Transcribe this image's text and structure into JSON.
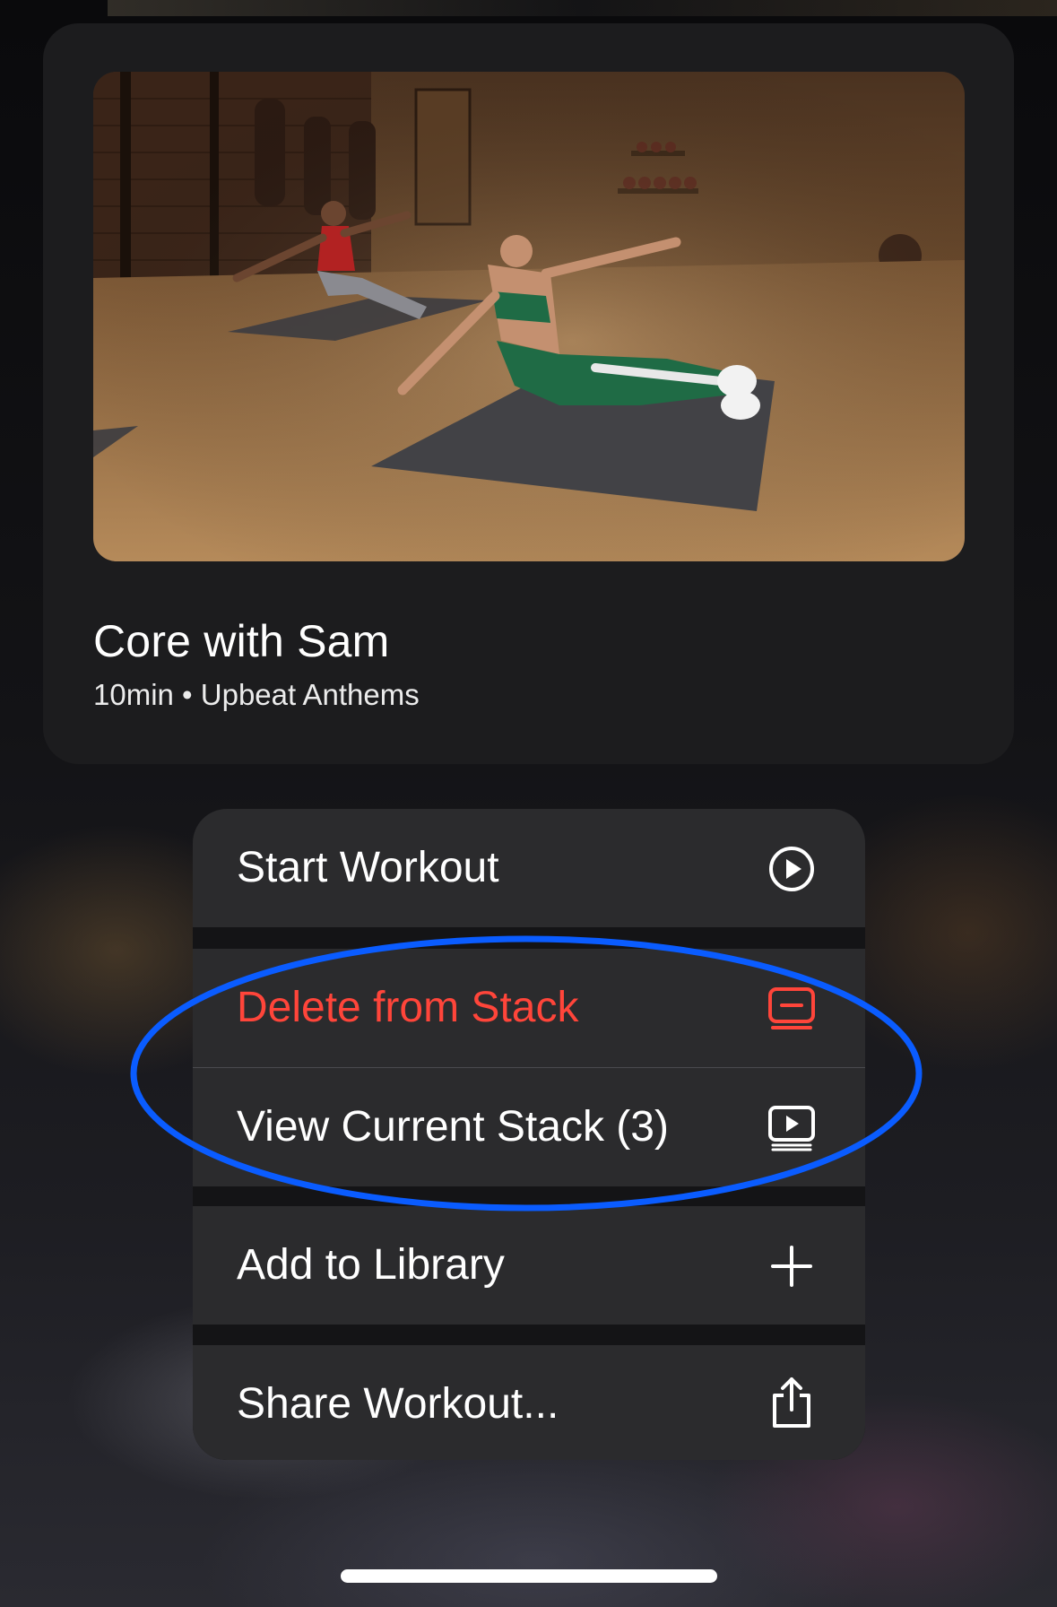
{
  "card": {
    "title": "Core with Sam",
    "subtitle": "10min • Upbeat Anthems"
  },
  "menu": {
    "items": [
      {
        "label": "Start Workout",
        "icon": "play-circle-icon",
        "destructive": false
      },
      {
        "label": "Delete from Stack",
        "icon": "remove-from-stack-icon",
        "destructive": true
      },
      {
        "label": "View Current Stack (3)",
        "icon": "view-stack-icon",
        "destructive": false
      },
      {
        "label": "Add to Library",
        "icon": "plus-icon",
        "destructive": false
      },
      {
        "label": "Share Workout...",
        "icon": "share-icon",
        "destructive": false
      }
    ]
  },
  "colors": {
    "destructive": "#ff453a",
    "annotation": "#0a5cff",
    "card_background": "#1c1c1e",
    "menu_item_background": "#2b2b2d"
  }
}
